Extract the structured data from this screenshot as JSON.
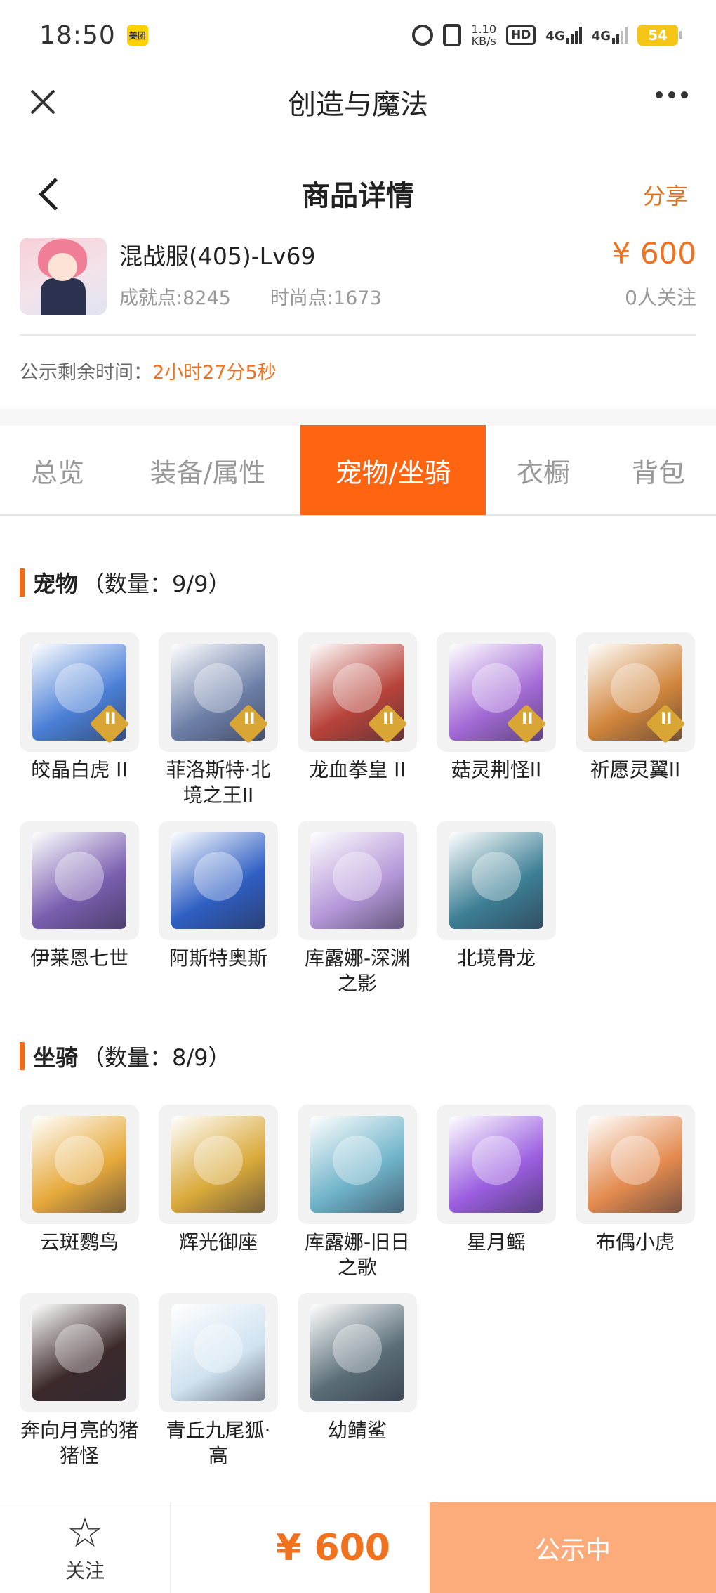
{
  "status_bar": {
    "time": "18:50",
    "meituan_label": "美团",
    "speed_value": "1.10",
    "speed_unit": "KB/s",
    "hd_label": "HD",
    "net1": "4G",
    "net2": "4G",
    "battery": "54"
  },
  "app": {
    "title": "创造与魔法"
  },
  "nav": {
    "title": "商品详情",
    "share_label": "分享"
  },
  "product": {
    "name": "混战服(405)-Lv69",
    "achievement": "成就点:8245",
    "fashion": "时尚点:1673",
    "price": "¥ 600",
    "followers": "0人关注",
    "timer_label": "公示剩余时间：",
    "timer_value": "2小时27分5秒"
  },
  "tabs": [
    "总览",
    "装备/属性",
    "宠物/坐骑",
    "衣橱",
    "背包"
  ],
  "active_tab_index": 2,
  "pets": {
    "title": "宠物",
    "count": "（数量：9/9）",
    "items": [
      {
        "name": "皎晶白虎 II",
        "icon": "white-tiger-icon",
        "color": "#4a7fd6",
        "rank": true
      },
      {
        "name": "菲洛斯特·北境之王II",
        "icon": "ice-king-icon",
        "color": "#6d7fa8",
        "rank": true
      },
      {
        "name": "龙血拳皇 II",
        "icon": "dragon-blood-boxer-icon",
        "color": "#b8433a",
        "rank": true
      },
      {
        "name": "菇灵荆怪II",
        "icon": "mushroom-sprite-icon",
        "color": "#a36ad6",
        "rank": true
      },
      {
        "name": "祈愿灵翼II",
        "icon": "wish-wing-bird-icon",
        "color": "#d0843a",
        "rank": true
      },
      {
        "name": "伊莱恩七世",
        "icon": "elaine-vii-icon",
        "color": "#7a5fb0",
        "rank": false
      },
      {
        "name": "阿斯特奥斯",
        "icon": "asteros-icon",
        "color": "#2f5fc4",
        "rank": false
      },
      {
        "name": "库露娜-深渊之影",
        "icon": "kuluna-abyss-icon",
        "color": "#b497d8",
        "rank": false
      },
      {
        "name": "北境骨龙",
        "icon": "bone-dragon-icon",
        "color": "#3d7f95",
        "rank": false
      }
    ]
  },
  "mounts": {
    "title": "坐骑",
    "count": "（数量：8/9）",
    "items": [
      {
        "name": "云斑鹦鸟",
        "icon": "cloud-parrot-icon",
        "color": "#e6a93b"
      },
      {
        "name": "辉光御座",
        "icon": "glow-throne-icon",
        "color": "#d9a93a"
      },
      {
        "name": "库露娜-旧日之歌",
        "icon": "kuluna-song-icon",
        "color": "#6fb3c9"
      },
      {
        "name": "星月鳐",
        "icon": "star-moon-ray-icon",
        "color": "#9b5ee0"
      },
      {
        "name": "布偶小虎",
        "icon": "plush-tiger-icon",
        "color": "#e38a4e"
      },
      {
        "name": "奔向月亮的猪猪怪",
        "icon": "moon-pig-icon",
        "color": "#3c2a2a"
      },
      {
        "name": "青丘九尾狐·高",
        "icon": "nine-tail-fox-icon",
        "color": "#cfe2f0"
      },
      {
        "name": "幼鲭鲨",
        "icon": "young-shark-icon",
        "color": "#5a6e78"
      }
    ]
  },
  "bottom_bar": {
    "follow_label": "关注",
    "price": "¥ 600",
    "status_label": "公示中"
  }
}
